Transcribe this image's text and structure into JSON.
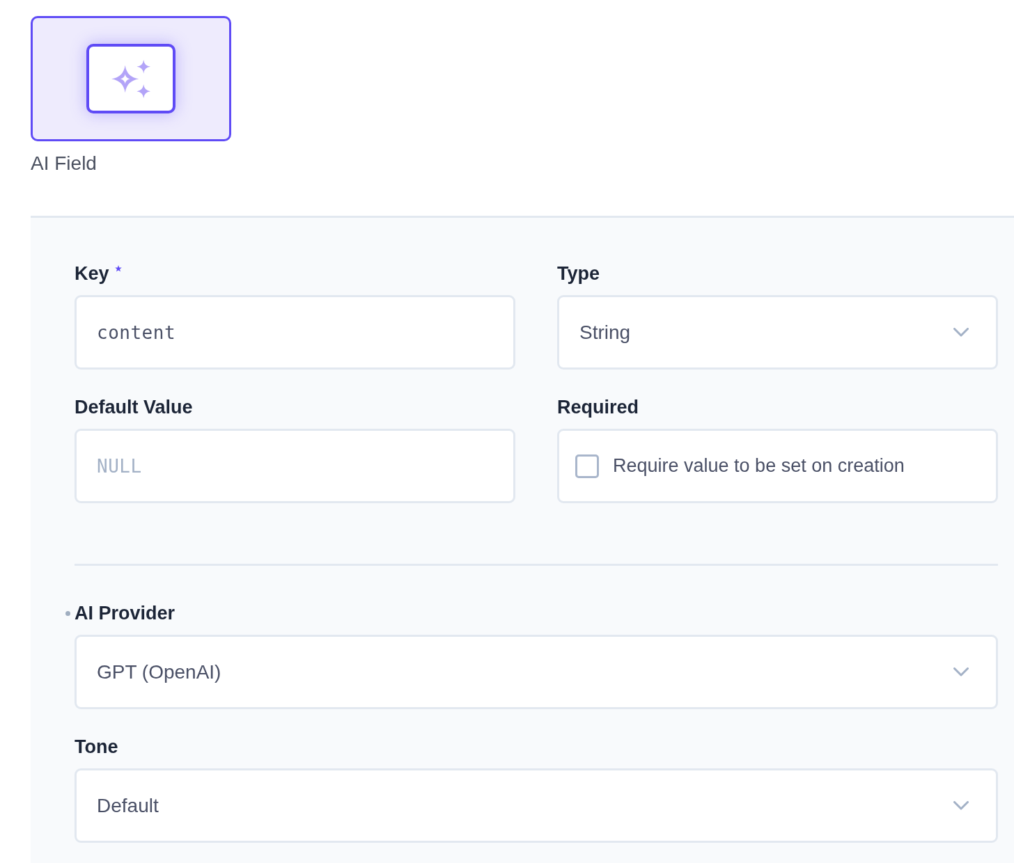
{
  "field_type_card": {
    "label": "AI Field",
    "selected": true
  },
  "form": {
    "fields": [
      {
        "kind": "text",
        "label": "Key",
        "required": true,
        "value": "content"
      },
      {
        "kind": "select",
        "label": "Type",
        "required": false,
        "value": "String"
      },
      {
        "kind": "text",
        "label": "Default Value",
        "required": false,
        "placeholder": "NULL"
      },
      {
        "kind": "checkbox",
        "label": "Required",
        "required": false,
        "text": "Require value to be set on creation",
        "checked": false
      }
    ]
  },
  "ai_section": {
    "fields": [
      {
        "kind": "select",
        "label": "AI Provider",
        "modified": true,
        "value": "GPT (OpenAI)"
      },
      {
        "kind": "select",
        "label": "Tone",
        "modified": false,
        "value": "Default"
      }
    ]
  }
}
